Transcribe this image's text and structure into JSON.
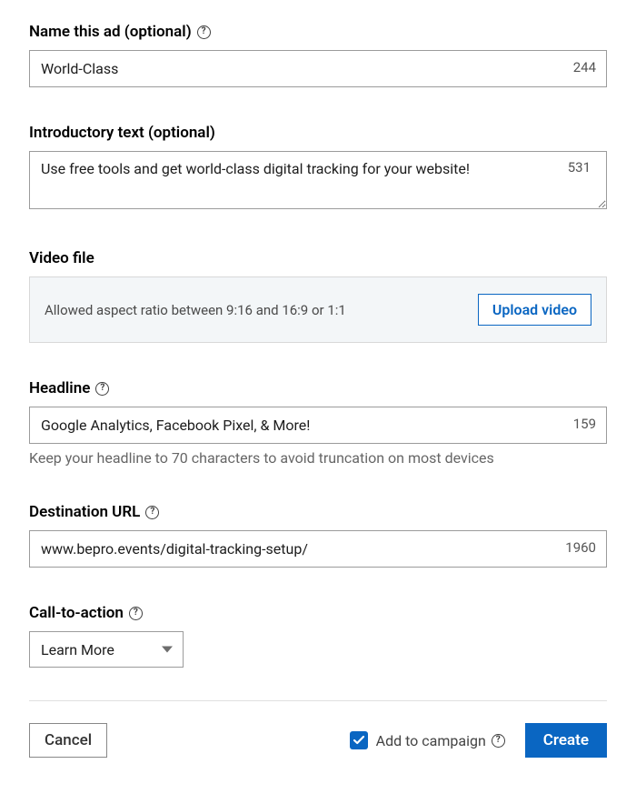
{
  "adName": {
    "label": "Name this ad (optional)",
    "value": "World-Class",
    "counter": "244"
  },
  "introText": {
    "label": "Introductory text (optional)",
    "value": "Use free tools and get world-class digital tracking for your website!",
    "counter": "531"
  },
  "videoFile": {
    "label": "Video file",
    "hint": "Allowed aspect ratio between 9:16 and 16:9 or 1:1",
    "button": "Upload video"
  },
  "headline": {
    "label": "Headline",
    "value": "Google Analytics, Facebook Pixel, & More!",
    "counter": "159",
    "helper": "Keep your headline to 70 characters to avoid truncation on most devices"
  },
  "destinationUrl": {
    "label": "Destination URL",
    "value": "www.bepro.events/digital-tracking-setup/",
    "counter": "1960"
  },
  "cta": {
    "label": "Call-to-action",
    "selected": "Learn More"
  },
  "footer": {
    "cancel": "Cancel",
    "addToCampaign": "Add to campaign",
    "addToCampaignChecked": true,
    "create": "Create"
  }
}
